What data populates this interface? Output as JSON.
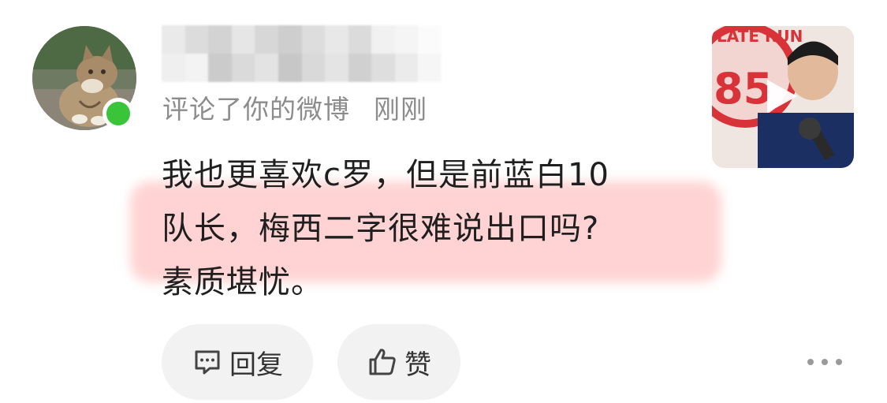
{
  "comment_card": {
    "meta": {
      "action": "评论了你的微博",
      "time": "刚刚"
    },
    "content": {
      "line1": "我也更喜欢c罗，但是前蓝白10",
      "line2": "队长，梅西二字很难说出口吗?",
      "line3": "素质堪忧。"
    },
    "actions": {
      "reply_label": "回复",
      "like_label": "赞"
    },
    "thumbnail": {
      "badge_number": "85",
      "badge_text": "LATE RUN"
    }
  },
  "icons": {
    "avatar": "cat-avatar",
    "online": "online-status-dot",
    "reply": "comment-bubble-icon",
    "like": "thumbs-up-icon",
    "play": "play-icon",
    "more": "more-dots-icon"
  },
  "colors": {
    "online": "#3ac43a",
    "highlight": "#ff9696",
    "meta_text": "#8c8c8c",
    "button_bg": "#f2f2f2"
  }
}
